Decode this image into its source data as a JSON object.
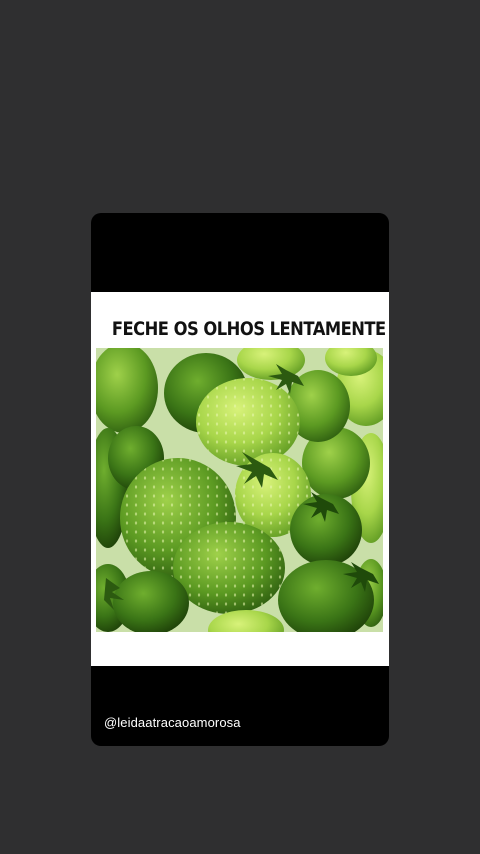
{
  "story": {
    "caption": "FECHE OS OLHOS LENTAMENTE",
    "image_subject": "green-strawberries",
    "username": "@leidaatracaoamorosa"
  },
  "colors": {
    "background": "#2f2f30",
    "card": "#000000",
    "panel": "#ffffff",
    "berry_light": "#b7e05a",
    "berry_dark": "#2f6a12"
  }
}
